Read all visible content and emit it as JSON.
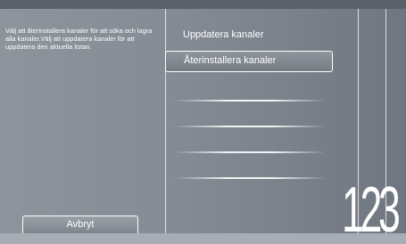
{
  "help": {
    "text": "Välj att återinstallera kanaler för att söka och lagra alla kanaler.Välj att uppdatera kanaler för att uppdatera den aktuella listan."
  },
  "buttons": {
    "cancel_label": "Avbryt"
  },
  "menu": {
    "items": [
      {
        "label": "Uppdatera kanaler",
        "selected": false
      },
      {
        "label": "Återinstallera kanaler",
        "selected": true
      }
    ]
  },
  "decoration": {
    "numbers": "123"
  },
  "colors": {
    "background": "#858c95",
    "highlight_border": "#ffffff",
    "text": "#ffffff"
  }
}
